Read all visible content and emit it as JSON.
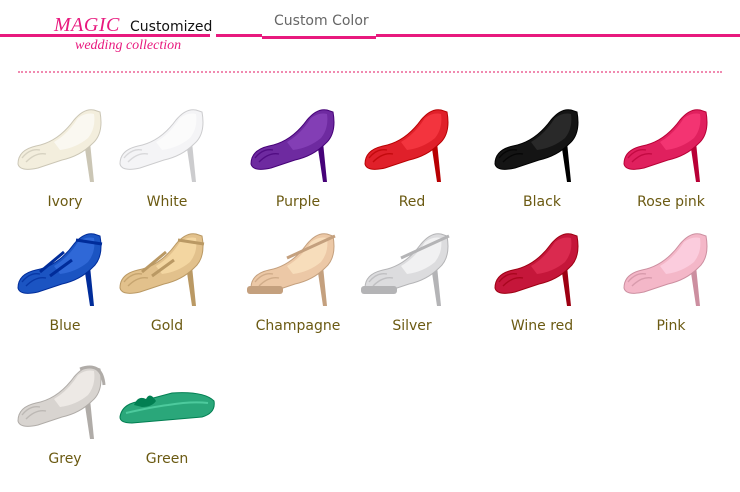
{
  "header": {
    "brand": "MAGIC",
    "customized": "Customized",
    "subtitle": "wedding collection",
    "tab_title": "Custom Color"
  },
  "colors": {
    "accent": "#e8197e",
    "label": "#6b5a12"
  },
  "shoes": [
    {
      "label": "Ivory",
      "color": "#f3eedd",
      "style": "pump"
    },
    {
      "label": "White",
      "color": "#f4f4f6",
      "style": "pump"
    },
    {
      "label": "Purple",
      "color": "#6e2aa0",
      "style": "pump"
    },
    {
      "label": "Red",
      "color": "#e0202a",
      "style": "pump"
    },
    {
      "label": "Black",
      "color": "#141414",
      "style": "pump"
    },
    {
      "label": "Rose pink",
      "color": "#e0205e",
      "style": "pump"
    },
    {
      "label": "Blue",
      "color": "#1b54c2",
      "style": "strappy"
    },
    {
      "label": "Gold",
      "color": "#e2c18c",
      "style": "strappy"
    },
    {
      "label": "Champagne",
      "color": "#ecc8a6",
      "style": "maryjane"
    },
    {
      "label": "Silver",
      "color": "#dcdcde",
      "style": "maryjane"
    },
    {
      "label": "Wine red",
      "color": "#c5163a",
      "style": "pump"
    },
    {
      "label": "Pink",
      "color": "#f4b7c8",
      "style": "pump"
    },
    {
      "label": "Grey",
      "color": "#d8d4d0",
      "style": "slingback"
    },
    {
      "label": "Green",
      "color": "#2aa77a",
      "style": "flat"
    }
  ]
}
